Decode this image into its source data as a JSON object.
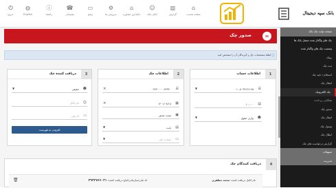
{
  "header": {
    "nav": [
      {
        "label": "خروج",
        "icon": "power-icon"
      },
      {
        "label": "English",
        "icon": "globe-icon"
      },
      {
        "label": "راهنما",
        "icon": "help-icon"
      },
      {
        "label": "پشتیبانی",
        "icon": "phone-icon"
      },
      {
        "label": "وتابع",
        "icon": "laptop-icon"
      },
      {
        "label": "سرویس ها",
        "icon": "cog-icon"
      },
      {
        "label": "بانکداری مشاوره",
        "icon": "bank-icon"
      },
      {
        "label": "کانال بانک",
        "icon": "person-icon"
      },
      {
        "label": "گزارش",
        "icon": "chart-icon"
      },
      {
        "label": "صفحه نخست",
        "icon": "home-icon"
      }
    ],
    "bank_name": "بانک سپه دیجیتال"
  },
  "sidebar": {
    "items": [
      {
        "label": "صفحه دولت چک بانک",
        "style": "grey"
      },
      {
        "label": "چک های واگذار شده متصل بانک ها",
        "style": "head"
      },
      {
        "label": "وضعیت چک های واگذار شده",
        "style": "head"
      },
      {
        "label": "پیچک",
        "style": "sub"
      },
      {
        "label": "ثبت چک",
        "style": "sub"
      },
      {
        "label": "استعلام / تایید چک",
        "style": "sub"
      },
      {
        "label": "انتقال چک",
        "style": "sub"
      },
      {
        "label": "چک الکترونیک",
        "style": "active"
      },
      {
        "label": "همگامی پرداخت",
        "style": "dim"
      },
      {
        "label": "صدور چک",
        "style": "sub"
      },
      {
        "label": "انتقال چک",
        "style": "sub"
      },
      {
        "label": "وصول چک",
        "style": "sub"
      },
      {
        "label": "ابطال چک",
        "style": "sub"
      },
      {
        "label": "گزارش درخواست های چک",
        "style": "sub"
      },
      {
        "label": "تسهیلات",
        "style": "bot"
      },
      {
        "label": "مدیریت",
        "style": "bot"
      }
    ]
  },
  "page": {
    "title": "صدور چک",
    "alert": "لطفا مشخصات چک و گیرندگان آن را مشخص کنید"
  },
  "panels": {
    "account": {
      "number": "1",
      "title": "اطلاعات حساب",
      "account_value": "۰۱۰-۸۰۳۴۶۶۶-۴۵",
      "amount_value": "۱۰،۰۰۰",
      "person_type": "وارتز حقوق"
    },
    "cheque": {
      "number": "2",
      "title": "اطلاعات چک",
      "serial_value": "۲۴۳۰۰۰۰۰۷۲۳۴۰",
      "date_value": "۱۴۰۱/۰۸/۱۸",
      "description_value": "تست صدور",
      "reason_value": "بابت",
      "extra_placeholder": "شماره ملی"
    },
    "receiver": {
      "number": "3",
      "title": "دریافت کننده چک",
      "type_value": "حقیقی",
      "name_placeholder": "نام کامل",
      "id_placeholder": "کد ملی",
      "add_button": "افزودن به فهرست"
    }
  },
  "receivers": {
    "number": "4",
    "title": "دریافت کنندگان چک",
    "rows": [
      {
        "name_label": "نام کامل دریافت کننده:",
        "name": "محمد مظفری",
        "id_label": "کد ملی/سازمانی/اتباع دریافت کننده:",
        "id": "۳۹۳۲۷۶۶۰۳۱"
      }
    ]
  },
  "colors": {
    "brand": "#c7161d",
    "button": "#2e5b8e",
    "sidebar": "#1b1b1b"
  }
}
